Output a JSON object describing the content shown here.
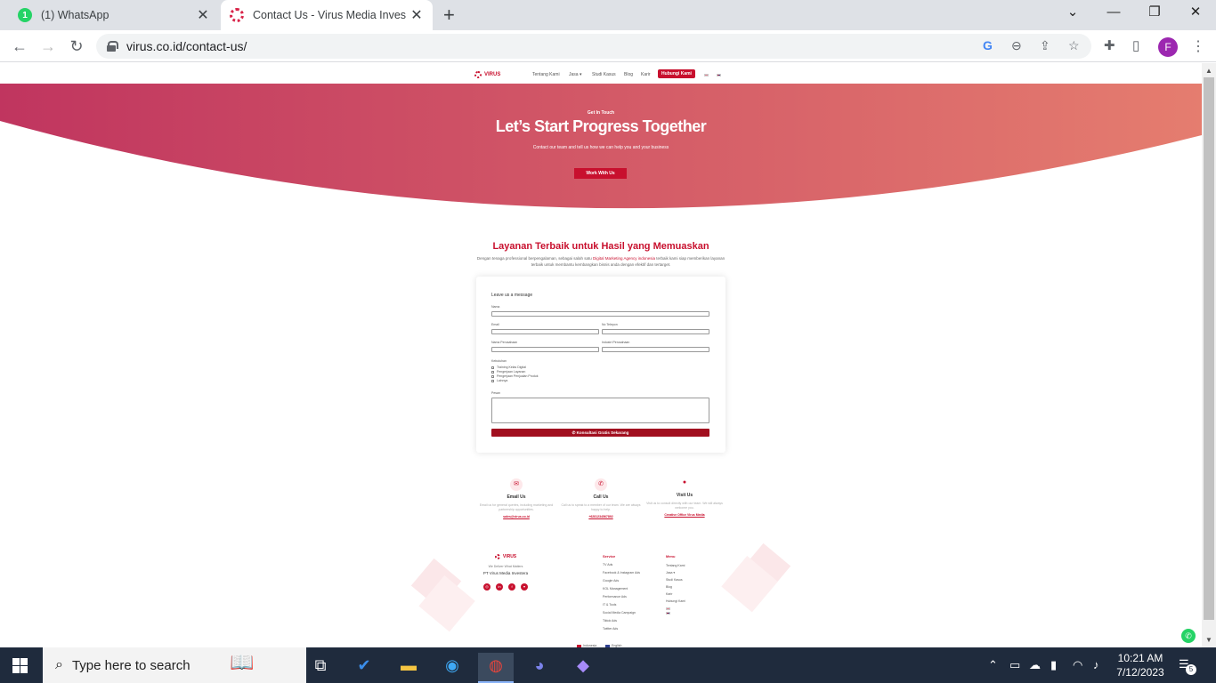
{
  "browser": {
    "tabs": [
      {
        "label": "(1) WhatsApp",
        "badge": "1"
      },
      {
        "label": "Contact Us - Virus Media Investa"
      }
    ],
    "new_tab": "+",
    "url": "virus.co.id/contact-us/",
    "profile_initial": "F"
  },
  "site": {
    "logo_text": "VIRUS",
    "nav": {
      "links": [
        "Tentang Kami",
        "Jasa ▾",
        "Studi Kasus",
        "Blog",
        "Karir"
      ],
      "cta": "Hubungi Kami"
    },
    "hero": {
      "eyebrow": "Get In Touch",
      "title": "Let’s Start Progress Together",
      "subtitle": "Contact our team and tell us how we can help you and your business",
      "button": "Work With Us"
    },
    "section": {
      "title": "Layanan Terbaik untuk Hasil yang Memuaskan",
      "desc_before": "Dengan tenaga professional berpengalaman, sebagai salah satu ",
      "desc_highlight": "Digital Marketing Agency indonesia",
      "desc_after": " terbaik kami siap memberikan layanan terbaik untuk membantu kembangkan bisnis anda dengan efektif dan tertarget."
    },
    "form": {
      "title": "Leave us a message",
      "fields": {
        "nama": "Nama",
        "email": "Email",
        "no_telepon": "No Telepon",
        "nama_perusahaan": "Nama Perusahaan",
        "industri": "Industri Perusahaan",
        "kebutuhan": "Kebutuhan",
        "pesan": "Pesan"
      },
      "options": [
        "Training Kelas Digital",
        "Pengerjaan Layanan",
        "Pengerjaan Penjualan Produk",
        "Lainnya"
      ],
      "submit": "✆ Konsultasi Gratis Sekarang"
    },
    "contact": [
      {
        "icon": "✉",
        "title": "Email Us",
        "desc": "Email us for general queries, including marketing and partnership opportunities.",
        "link": "sales@virus.co.id"
      },
      {
        "icon": "✆",
        "title": "Call Us",
        "desc": "Call us to speak to a member of our team. We are always happy to help.",
        "link": "+6281234567892"
      },
      {
        "icon": "●",
        "title": "Visit Us",
        "desc": "Visit us to consult directly with our team. We will always welcome you.",
        "link": "Creative Office Virus Media"
      }
    ],
    "footer": {
      "tagline": "We Deliver What Matters",
      "company": "PT Virus Media Investera",
      "social": [
        "◎",
        "in",
        "f",
        "▾"
      ],
      "service_title": "Service",
      "services": [
        "TV Ads",
        "Facebook & Instagram Ads",
        "Google Ads",
        "KOL Management",
        "Performance Ads",
        "IT & Tools",
        "Social Media Campaign",
        "Tiktok Ads",
        "Twitter Ads"
      ],
      "menu_title": "Menu",
      "menu": [
        "Tentang Kami",
        "Jasa ▾",
        "Studi Kasus",
        "Blog",
        "Karir",
        "Hubungi Kami"
      ],
      "languages": [
        "Indonesia",
        "English"
      ]
    },
    "whatsapp_float": "✆"
  },
  "taskbar": {
    "search_placeholder": "Type here to search",
    "time": "10:21 AM",
    "date": "7/12/2023",
    "notification_count": "5"
  },
  "colors": {
    "brand": "#c8102e",
    "hero_start": "#c0355f",
    "hero_end": "#e57d6f",
    "taskbar": "#1f2b3d"
  }
}
